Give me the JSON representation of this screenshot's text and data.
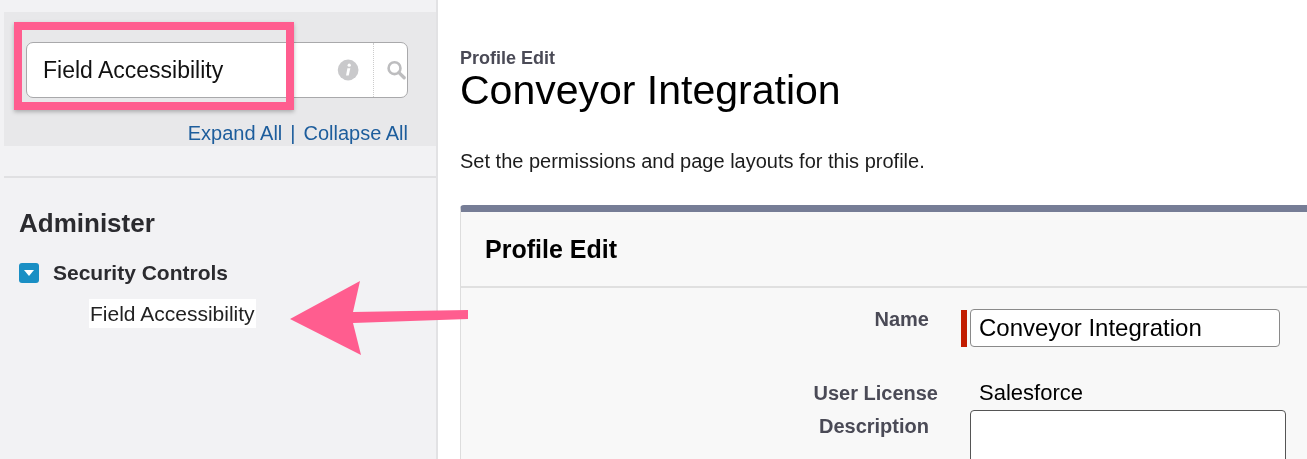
{
  "sidebar": {
    "search": {
      "value": "Field Accessibility"
    },
    "links": [
      "Expand All",
      "Collapse All"
    ],
    "separator": "|",
    "section_title": "Administer",
    "tree": [
      {
        "label": "Security Controls",
        "expanded": true,
        "children": [
          {
            "label": "Field Accessibility",
            "selected": true
          }
        ]
      }
    ]
  },
  "main": {
    "breadcrumb": "Profile Edit",
    "title": "Conveyor Integration",
    "description": "Set the permissions and page layouts for this profile.",
    "panel": {
      "title": "Profile Edit",
      "fields": [
        {
          "kind": "text",
          "label": "Name",
          "value": "Conveyor Integration",
          "required": true
        },
        {
          "kind": "static",
          "label": "User License",
          "value": "Salesforce"
        },
        {
          "kind": "textarea",
          "label": "Description"
        }
      ]
    }
  }
}
